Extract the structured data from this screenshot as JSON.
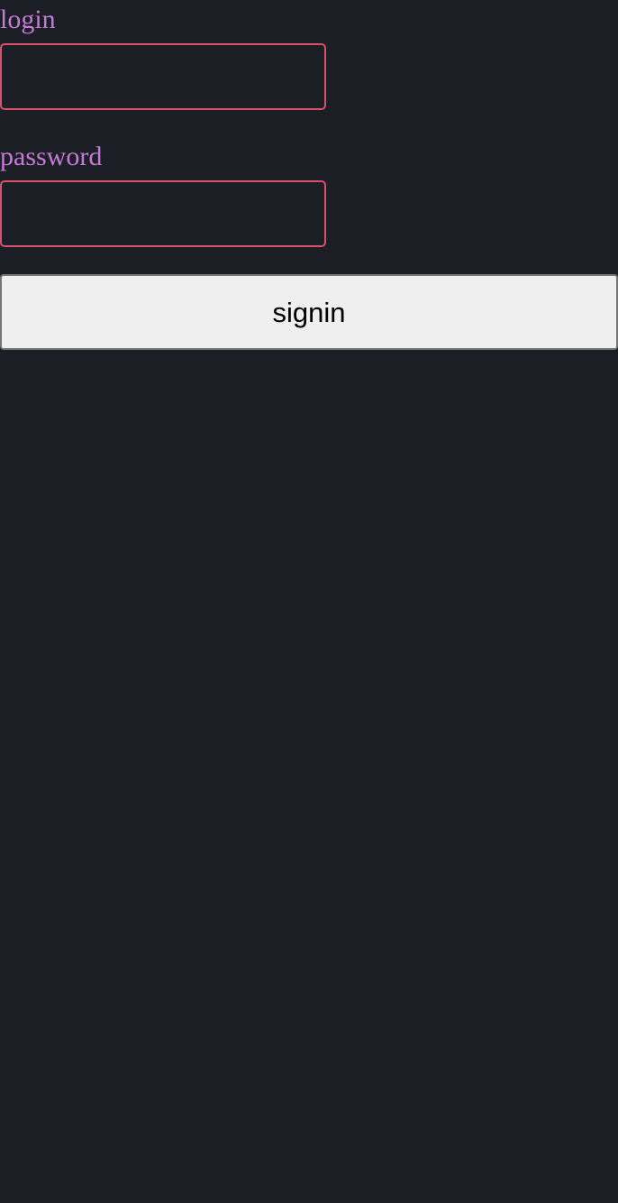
{
  "form": {
    "login_label": "login",
    "login_value": "",
    "password_label": "password",
    "password_value": "",
    "signin_label": "signin"
  },
  "colors": {
    "background": "#1c1e25",
    "label_text": "#c67ad8",
    "input_border": "#d8506c",
    "button_background": "#efefef",
    "button_border": "#767676",
    "button_text": "#000000"
  }
}
